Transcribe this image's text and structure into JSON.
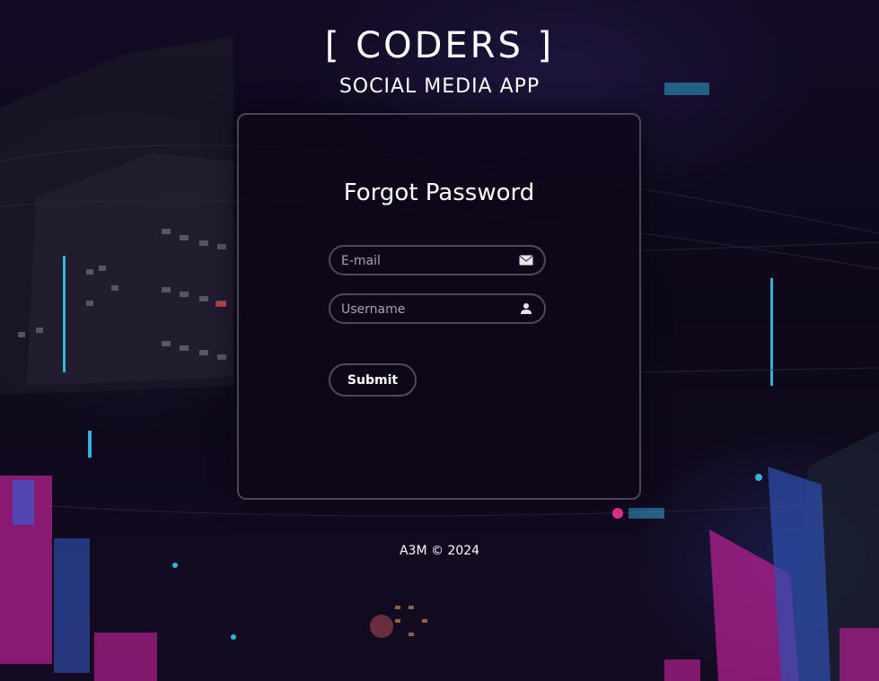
{
  "header": {
    "brand": "[ CODERS ]",
    "subtitle": "SOCIAL MEDIA APP"
  },
  "form": {
    "title": "Forgot Password",
    "email_placeholder": "E-mail",
    "email_icon": "envelope-icon",
    "username_placeholder": "Username",
    "username_icon": "user-icon",
    "submit_label": "Submit"
  },
  "footer": {
    "text": "A3M © 2024"
  },
  "theme": {
    "card_border": "#4a4554",
    "card_bg": "#0e071a",
    "text": "#ffffff",
    "placeholder": "#a9a4b3"
  }
}
